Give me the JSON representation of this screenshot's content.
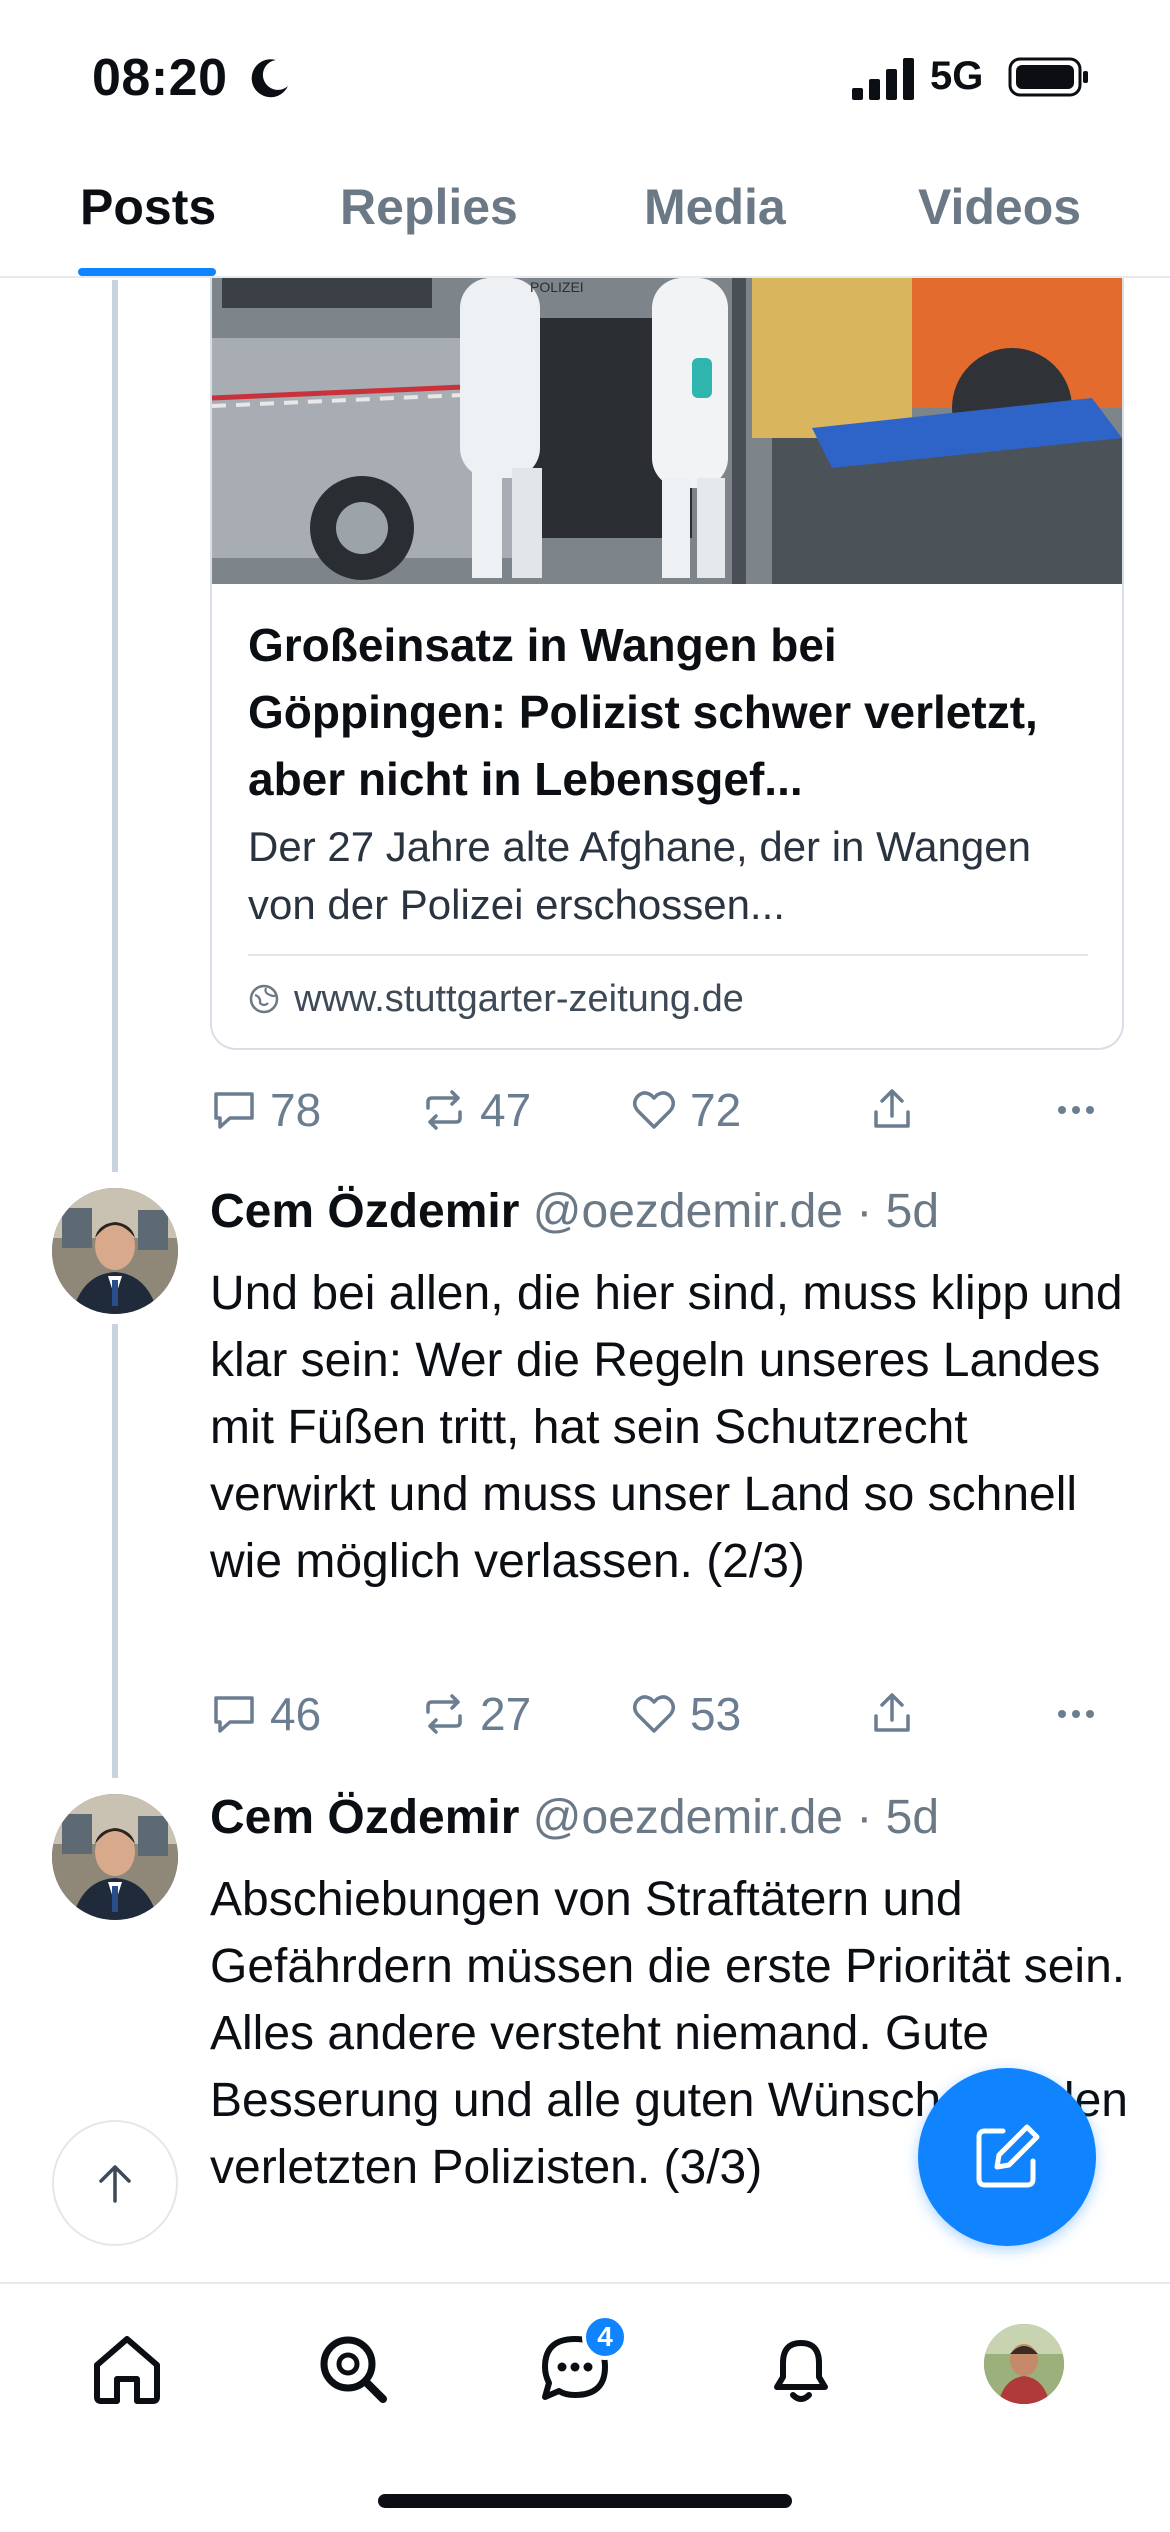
{
  "status_bar": {
    "time": "08:20",
    "network": "5G"
  },
  "tabs": [
    {
      "label": "Posts",
      "active": true
    },
    {
      "label": "Replies",
      "active": false
    },
    {
      "label": "Media",
      "active": false
    },
    {
      "label": "Videos",
      "active": false
    }
  ],
  "link_card": {
    "title": "Großeinsatz in Wangen bei Göppingen: Polizist schwer verletzt, aber nicht in Lebensgef...",
    "description": "Der 27 Jahre alte Afghane, der in Wangen von der Polizei erschossen...",
    "domain": "www.stuttgarter-zeitung.de",
    "image_text": "POLIZEI"
  },
  "first_post_actions": {
    "replies": "78",
    "reposts": "47",
    "likes": "72"
  },
  "posts": [
    {
      "name": "Cem Özdemir",
      "handle": "@oezdemir.de",
      "dot": "·",
      "time": "5d",
      "text": "Und bei allen, die hier sind, muss klipp und klar sein: Wer die Regeln unseres Landes mit Füßen tritt, hat sein Schutzrecht verwirkt und muss unser Land so schnell wie möglich verlassen. (2/3)",
      "replies": "46",
      "reposts": "27",
      "likes": "53"
    },
    {
      "name": "Cem Özdemir",
      "handle": "@oezdemir.de",
      "dot": "·",
      "time": "5d",
      "text": "Abschiebungen von Straftätern und Gefährdern müssen die erste Priorität sein. Alles andere versteht niemand. Gute Besserung und alle guten Wünsche an den verletzten Polizisten. (3/3)"
    }
  ],
  "bottom_nav": {
    "chat_badge": "4"
  },
  "icons": [
    "moon-icon",
    "signal-icon",
    "battery-icon",
    "globe-icon",
    "reply-icon",
    "repost-icon",
    "like-icon",
    "share-icon",
    "more-icon",
    "arrow-up-icon",
    "compose-icon",
    "home-icon",
    "search-icon",
    "chat-icon",
    "bell-icon"
  ],
  "colors": {
    "accent": "#1083fe",
    "muted": "#6b7886",
    "thread": "#c9d3dd"
  }
}
